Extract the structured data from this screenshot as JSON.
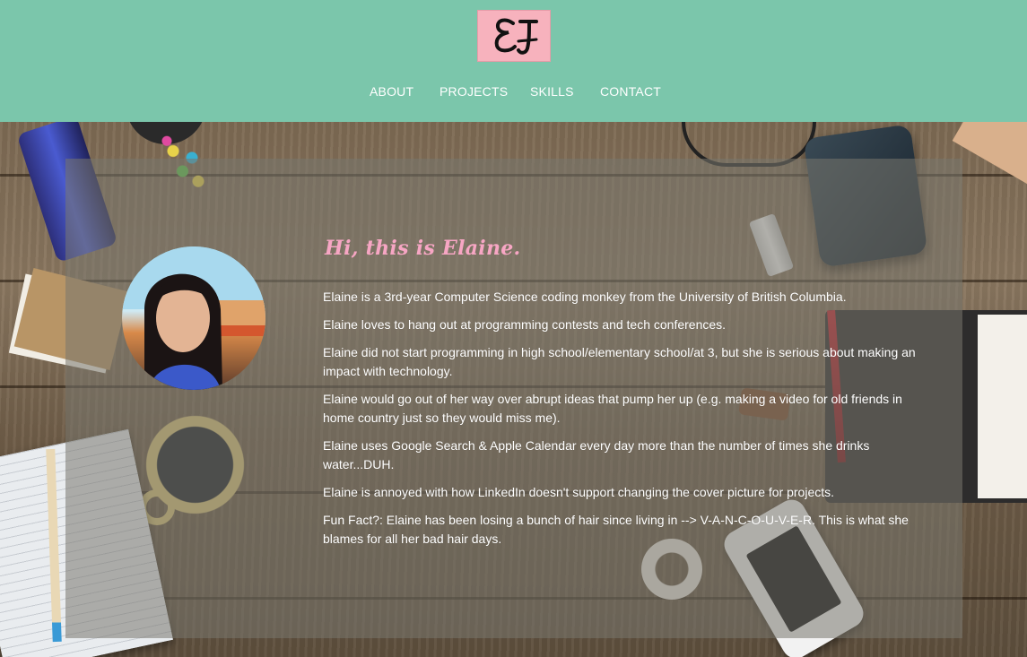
{
  "logo": {
    "text": "EJ"
  },
  "nav": {
    "items": [
      "ABOUT",
      "PROJECTS",
      "SKILLS",
      "CONTACT"
    ]
  },
  "about": {
    "greeting": "Hi, this is Elaine.",
    "paragraphs": [
      "Elaine is a 3rd-year Computer Science coding monkey from the University of British Columbia.",
      "Elaine loves to hang out at programming contests and tech conferences.",
      "Elaine did not start programming in high school/elementary school/at 3, but she is serious about making an impact with technology.",
      "Elaine would go out of her way over abrupt ideas that pump her up (e.g. making a video for old friends in home country just so they would miss me).",
      "Elaine uses Google Search & Apple Calendar every day more than the number of times she drinks water...DUH.",
      "Elaine is annoyed with how LinkedIn doesn't support changing the cover picture for projects.",
      "Fun Fact?: Elaine has been losing a bunch of hair since living in --> V-A-N-C-O-U-V-E-R. This is what she blames for all her bad hair days."
    ]
  },
  "colors": {
    "header": "#7bc6ab",
    "accent_pink": "#f7a6c4",
    "text": "#ffffff"
  },
  "icons": [
    "logo-icon",
    "profile-photo"
  ]
}
